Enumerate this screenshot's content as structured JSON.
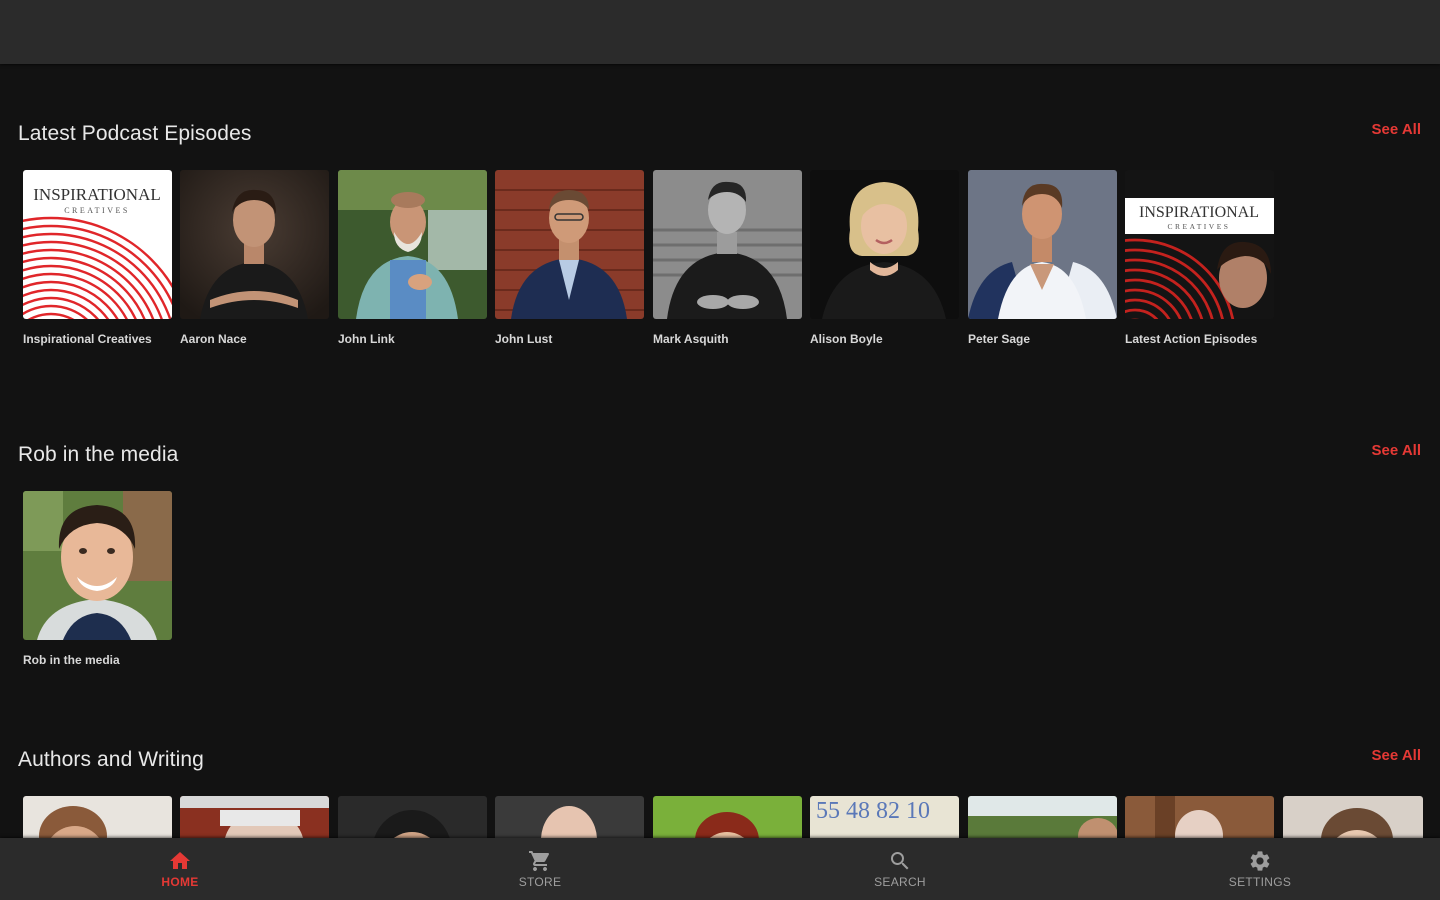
{
  "colors": {
    "accent": "#e53935",
    "background": "#121212",
    "bar": "#2b2b2b"
  },
  "sections": [
    {
      "title": "Latest Podcast Episodes",
      "see_all": "See All",
      "items": [
        {
          "label": "Inspirational Creatives"
        },
        {
          "label": "Aaron Nace"
        },
        {
          "label": "John Link"
        },
        {
          "label": "John Lust"
        },
        {
          "label": "Mark Asquith"
        },
        {
          "label": "Alison Boyle"
        },
        {
          "label": "Peter Sage"
        },
        {
          "label": "Latest Action Episodes"
        }
      ]
    },
    {
      "title": "Rob in the media",
      "see_all": "See All",
      "items": [
        {
          "label": "Rob in the media"
        }
      ]
    },
    {
      "title": "Authors and Writing",
      "see_all": "See All",
      "items": []
    }
  ],
  "logo_text": {
    "line1": "INSPIRATIONAL",
    "line2": "CREATIVES"
  },
  "sign_number": "55 48 82 10",
  "bottom_nav": [
    {
      "label": "HOME",
      "icon": "home-icon",
      "active": true
    },
    {
      "label": "STORE",
      "icon": "cart-icon",
      "active": false
    },
    {
      "label": "SEARCH",
      "icon": "search-icon",
      "active": false
    },
    {
      "label": "SETTINGS",
      "icon": "gear-icon",
      "active": false
    }
  ]
}
